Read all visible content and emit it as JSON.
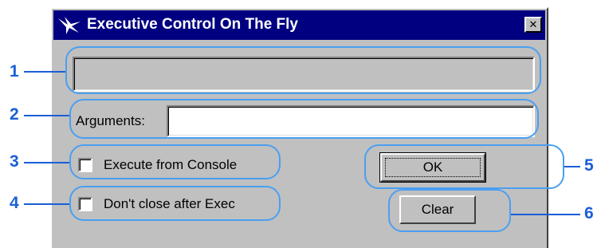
{
  "window": {
    "title": "Executive Control On The Fly",
    "close_symbol": "✕"
  },
  "command_field": {
    "value": ""
  },
  "arguments": {
    "label": "Arguments:",
    "value": ""
  },
  "checkboxes": [
    {
      "label": "Execute from Console",
      "checked": false
    },
    {
      "label": "Don't close after Exec",
      "checked": false
    }
  ],
  "buttons": {
    "ok": "OK",
    "clear": "Clear"
  },
  "callouts": {
    "c1": "1",
    "c2": "2",
    "c3": "3",
    "c4": "4",
    "c5": "5",
    "c6": "6"
  },
  "colors": {
    "titlebar": "#000080",
    "window_face": "#c0c0c0",
    "callout_outline": "#4a9ff0",
    "callout_number": "#1a5fd6"
  },
  "icons": [
    "app-icon",
    "close-icon",
    "checkbox-icon"
  ]
}
